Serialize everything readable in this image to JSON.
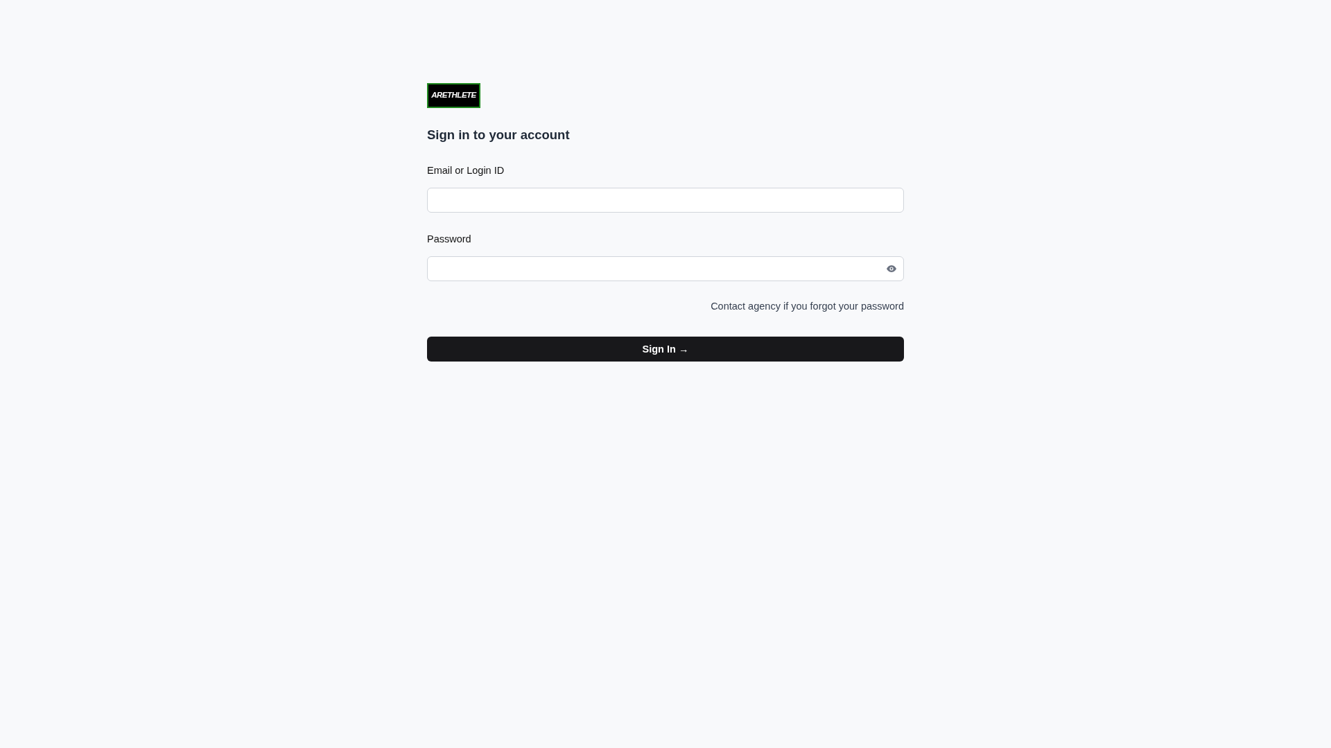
{
  "logo": {
    "text": "ARETHLETE"
  },
  "heading": "Sign in to your account",
  "fields": [
    {
      "label": "Email or Login ID",
      "kind": "text"
    },
    {
      "label": "Password",
      "kind": "password"
    }
  ],
  "help_text": "Contact agency if you forgot your password",
  "submit": {
    "label": "Sign In →"
  }
}
